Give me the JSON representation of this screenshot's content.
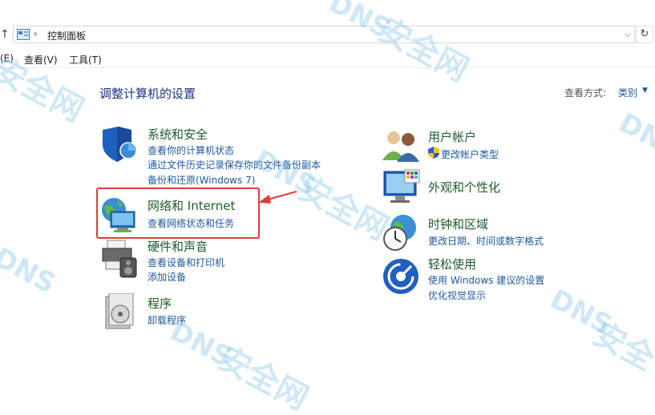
{
  "address_bar": {
    "path_label": "控制面板",
    "separator": "›",
    "up_glyph": "↑",
    "dropdown_glyph": "⌵",
    "refresh_glyph": "↻"
  },
  "menubar": {
    "items": [
      "(E)",
      "查看(V)",
      "工具(T)"
    ]
  },
  "header": {
    "title": "调整计算机的设置",
    "view_by_label": "查看方式:",
    "view_by_value": "类别"
  },
  "categories": {
    "system_security": {
      "title": "系统和安全",
      "links": [
        "查看你的计算机状态",
        "通过文件历史记录保存你的文件备份副本",
        "备份和还原(Windows 7)"
      ]
    },
    "network_internet": {
      "title": "网络和 Internet",
      "links": [
        "查看网络状态和任务"
      ]
    },
    "hardware_sound": {
      "title": "硬件和声音",
      "links": [
        "查看设备和打印机",
        "添加设备"
      ]
    },
    "programs": {
      "title": "程序",
      "links": [
        "卸载程序"
      ]
    },
    "user_accounts": {
      "title": "用户帐户",
      "links": [
        "更改帐户类型"
      ]
    },
    "appearance": {
      "title": "外观和个性化",
      "links": []
    },
    "clock_region": {
      "title": "时钟和区域",
      "links": [
        "更改日期、时间或数字格式"
      ]
    },
    "ease_of_access": {
      "title": "轻松使用",
      "links": [
        "使用 Windows 建议的设置",
        "优化视觉显示"
      ]
    }
  },
  "watermark": {
    "brand": "DNS",
    "text": "安全网"
  },
  "colors": {
    "title_blue": "#1e3287",
    "link_blue": "#1e5aa0",
    "category_green": "#1e5a2c",
    "highlight_red": "#e23b3b"
  }
}
